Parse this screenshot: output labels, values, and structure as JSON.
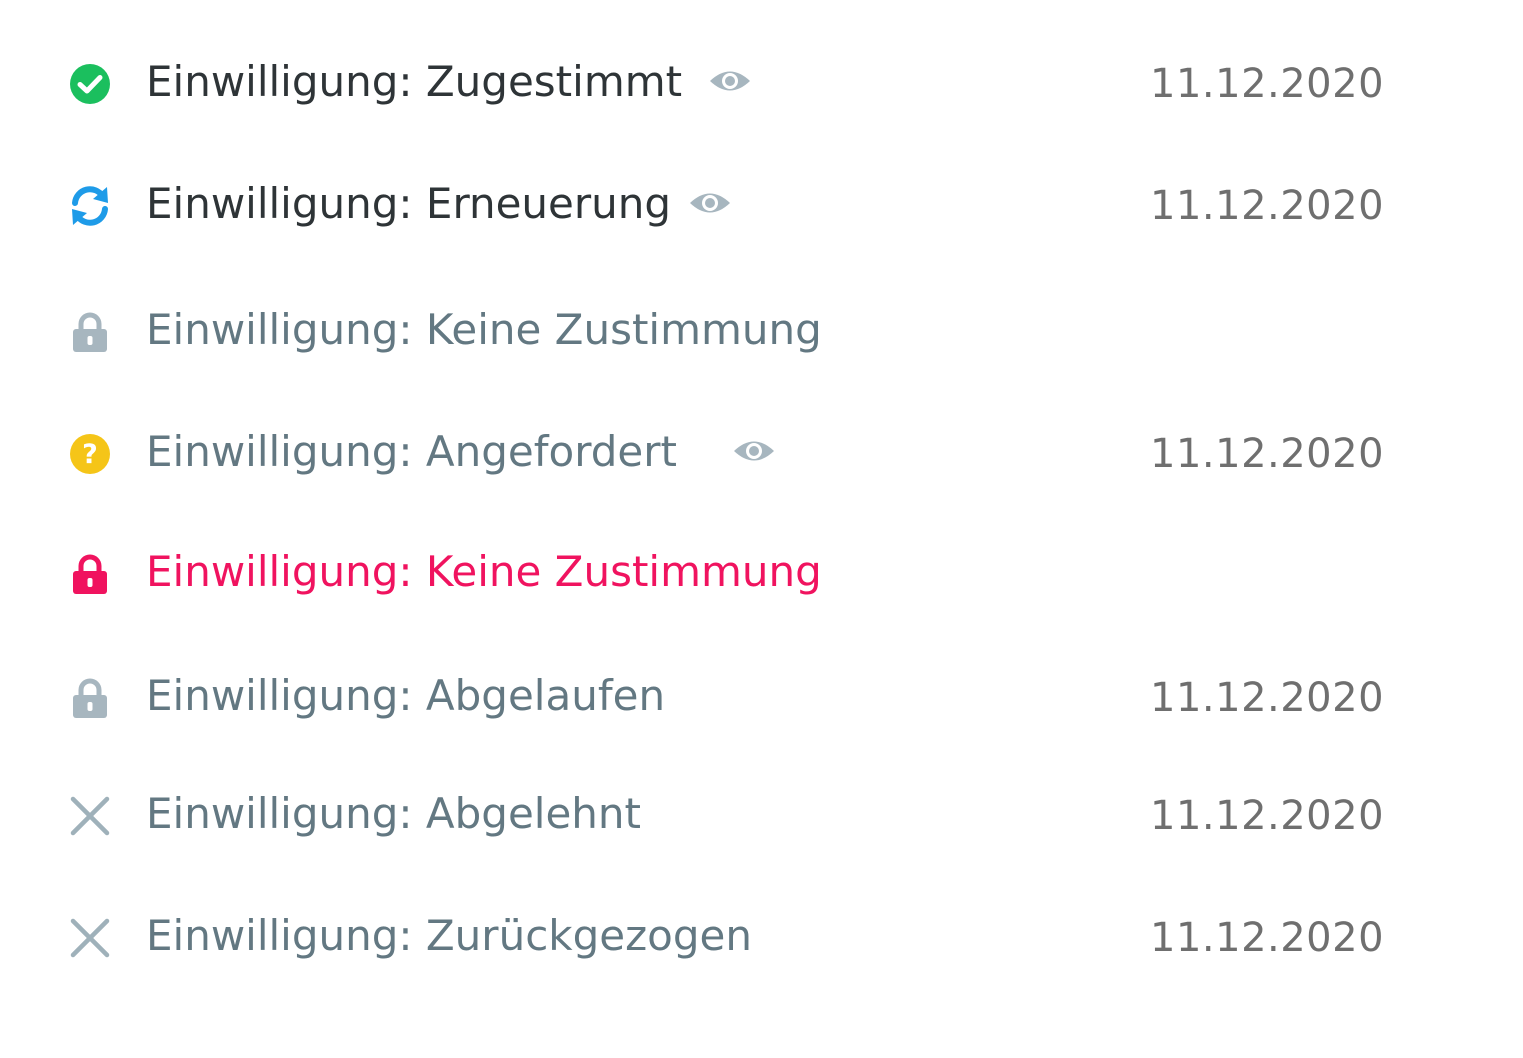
{
  "colors": {
    "approved": "#1bbf5e",
    "renewal": "#1e9be8",
    "locked_neutral": "#a7b6bf",
    "requested": "#f5c518",
    "locked_alert": "#f0135f",
    "rejected": "#9fb1ba",
    "eye": "#a7b6bf",
    "label_dark": "#2e3437",
    "label_muted": "#637882",
    "date": "#6f6f6f"
  },
  "items": [
    {
      "icon": "check-circle-icon",
      "label": "Einwilligung: Zugestimmt",
      "show_eye": true,
      "date": "11.12.2020"
    },
    {
      "icon": "refresh-icon",
      "label": "Einwilligung: Erneuerung",
      "show_eye": true,
      "date": "11.12.2020"
    },
    {
      "icon": "lock-icon",
      "label": "Einwilligung: Keine Zustimmung",
      "show_eye": false,
      "date": ""
    },
    {
      "icon": "question-circle-icon",
      "label": "Einwilligung: Angefordert",
      "show_eye": true,
      "date": "11.12.2020"
    },
    {
      "icon": "lock-icon",
      "label": "Einwilligung: Keine Zustimmung",
      "show_eye": false,
      "date": ""
    },
    {
      "icon": "lock-icon",
      "label": "Einwilligung: Abgelaufen",
      "show_eye": false,
      "date": "11.12.2020"
    },
    {
      "icon": "close-icon",
      "label": "Einwilligung: Abgelehnt",
      "show_eye": false,
      "date": "11.12.2020"
    },
    {
      "icon": "close-icon",
      "label": "Einwilligung: Zurückgezogen",
      "show_eye": false,
      "date": "11.12.2020"
    }
  ]
}
